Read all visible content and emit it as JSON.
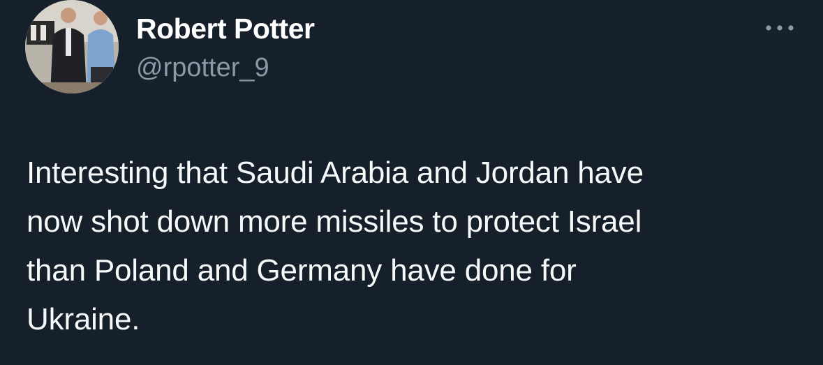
{
  "author": {
    "display_name": "Robert Potter",
    "handle": "@rpotter_9",
    "avatar_icon": "profile-photo"
  },
  "more_icon": "more-options-icon",
  "tweet": {
    "text_lines": [
      "Interesting that Saudi Arabia and Jordan have",
      "now shot down more missiles to protect Israel",
      "than Poland and Germany have done for",
      "Ukraine."
    ]
  },
  "colors": {
    "background": "#15202b",
    "primary_text": "#f7f9f9",
    "secondary_text": "#8b98a5"
  }
}
